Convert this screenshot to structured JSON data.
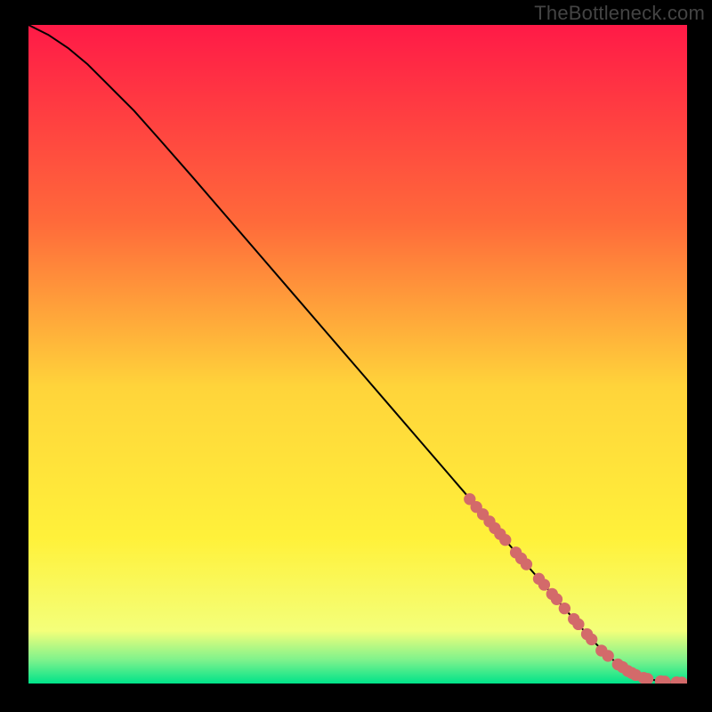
{
  "watermark": "TheBottleneck.com",
  "chart_data": {
    "type": "line",
    "title": "",
    "xlabel": "",
    "ylabel": "",
    "xlim": [
      0,
      100
    ],
    "ylim": [
      0,
      100
    ],
    "background_gradient": {
      "stops": [
        {
          "pos": 0.0,
          "color": "#ff1a47"
        },
        {
          "pos": 0.3,
          "color": "#ff6a3a"
        },
        {
          "pos": 0.55,
          "color": "#ffd43a"
        },
        {
          "pos": 0.78,
          "color": "#fff13a"
        },
        {
          "pos": 0.92,
          "color": "#f4ff7a"
        },
        {
          "pos": 0.965,
          "color": "#7cf28c"
        },
        {
          "pos": 1.0,
          "color": "#00e38a"
        }
      ]
    },
    "series": [
      {
        "name": "curve",
        "color": "#000000",
        "x": [
          0,
          3,
          6,
          9,
          12,
          16,
          20,
          25,
          30,
          35,
          40,
          45,
          50,
          55,
          60,
          65,
          70,
          74,
          78,
          80,
          82,
          84,
          86,
          88,
          90,
          92,
          94,
          96,
          98,
          100
        ],
        "y": [
          100,
          98.5,
          96.5,
          94,
          91,
          87,
          82.5,
          76.8,
          71,
          65.2,
          59.4,
          53.6,
          47.8,
          42,
          36.2,
          30.4,
          24.6,
          19.9,
          15.3,
          13,
          10.7,
          8.4,
          6.2,
          4.2,
          2.6,
          1.4,
          0.7,
          0.35,
          0.18,
          0.12
        ]
      }
    ],
    "markers": {
      "name": "highlighted-segment",
      "color": "#d36a6a",
      "radius_pct": 0.9,
      "points": [
        {
          "x": 67,
          "y": 28.0
        },
        {
          "x": 68,
          "y": 26.8
        },
        {
          "x": 69,
          "y": 25.7
        },
        {
          "x": 70,
          "y": 24.6
        },
        {
          "x": 70.8,
          "y": 23.6
        },
        {
          "x": 71.6,
          "y": 22.7
        },
        {
          "x": 72.4,
          "y": 21.8
        },
        {
          "x": 74,
          "y": 19.9
        },
        {
          "x": 74.8,
          "y": 19.0
        },
        {
          "x": 75.6,
          "y": 18.1
        },
        {
          "x": 77.5,
          "y": 15.9
        },
        {
          "x": 78.3,
          "y": 15.0
        },
        {
          "x": 79.5,
          "y": 13.6
        },
        {
          "x": 80.2,
          "y": 12.8
        },
        {
          "x": 81.4,
          "y": 11.4
        },
        {
          "x": 82.8,
          "y": 9.8
        },
        {
          "x": 83.5,
          "y": 9.0
        },
        {
          "x": 84.8,
          "y": 7.5
        },
        {
          "x": 85.5,
          "y": 6.7
        },
        {
          "x": 87.0,
          "y": 5.0
        },
        {
          "x": 88.0,
          "y": 4.2
        },
        {
          "x": 89.5,
          "y": 2.9
        },
        {
          "x": 90.2,
          "y": 2.5
        },
        {
          "x": 91.0,
          "y": 1.9
        },
        {
          "x": 91.6,
          "y": 1.6
        },
        {
          "x": 92.2,
          "y": 1.3
        },
        {
          "x": 93.4,
          "y": 0.85
        },
        {
          "x": 94.0,
          "y": 0.7
        },
        {
          "x": 96.0,
          "y": 0.35
        },
        {
          "x": 96.6,
          "y": 0.3
        },
        {
          "x": 98.4,
          "y": 0.18
        },
        {
          "x": 99.2,
          "y": 0.14
        }
      ]
    }
  }
}
